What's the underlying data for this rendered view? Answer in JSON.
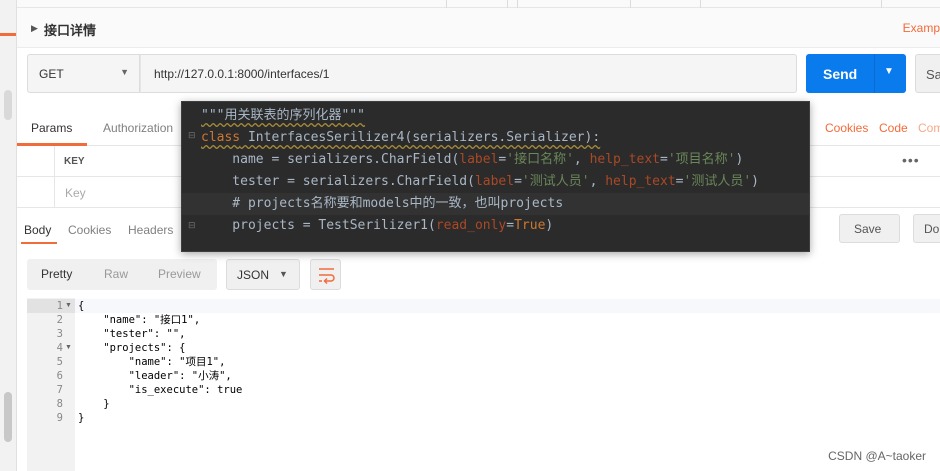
{
  "request": {
    "title": "接口详情",
    "examples_label": "Examp",
    "method": "GET",
    "url": "http://127.0.0.1:8000/interfaces/1",
    "send_label": "Send",
    "save_label": "Sa"
  },
  "request_tabs": {
    "params": "Params",
    "authorization": "Authorization",
    "cookies": "Cookies",
    "code": "Code",
    "comments": "Com"
  },
  "params_table": {
    "key_header": "KEY",
    "key_placeholder": "Key",
    "more": "•••"
  },
  "response_tabs": {
    "body": "Body",
    "cookies": "Cookies",
    "headers": "Headers",
    "save_response": "Save",
    "download": "Do"
  },
  "view_modes": {
    "pretty": "Pretty",
    "raw": "Raw",
    "preview": "Preview",
    "language": "JSON"
  },
  "response_body": {
    "line_numbers": [
      "1",
      "2",
      "3",
      "4",
      "5",
      "6",
      "7",
      "8",
      "9"
    ],
    "lines": [
      "{",
      "    \"name\": \"接口1\",",
      "    \"tester\": \"\",",
      "    \"projects\": {",
      "        \"name\": \"项目1\",",
      "        \"leader\": \"小涛\",",
      "        \"is_execute\": true",
      "    }",
      "}"
    ]
  },
  "ide_snippet": {
    "lines": [
      "\"\"\"用关联表的序列化器\"\"\"",
      "class InterfacesSerilizer4(serializers.Serializer):",
      "    name = serializers.CharField(label='接口名称', help_text='项目名称')",
      "    tester = serializers.CharField(label='测试人员', help_text='测试人员')",
      "    # projects名称要和models中的一致，也叫projects",
      "    projects = TestSerilizer1(read_only=True)"
    ]
  },
  "watermark": "CSDN @A~taoker",
  "colors": {
    "accent": "#f26b3a",
    "send_button": "#097bed",
    "ide_background": "#2b2b2b"
  }
}
